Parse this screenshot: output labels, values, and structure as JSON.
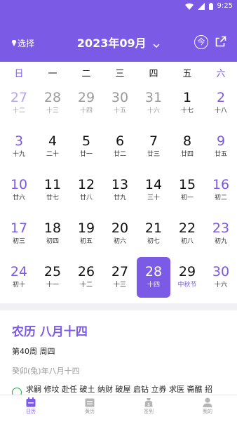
{
  "status": {
    "time": "9:25"
  },
  "header": {
    "location_label": "选择",
    "month_title": "2023年09月",
    "today_label": "今"
  },
  "weekdays": [
    {
      "label": "日",
      "weekend": true
    },
    {
      "label": "一",
      "weekend": false
    },
    {
      "label": "二",
      "weekend": false
    },
    {
      "label": "三",
      "weekend": false
    },
    {
      "label": "四",
      "weekend": false
    },
    {
      "label": "五",
      "weekend": false
    },
    {
      "label": "六",
      "weekend": true
    }
  ],
  "calendar_weeks": [
    [
      {
        "day": "27",
        "lunar": "十二",
        "other": true
      },
      {
        "day": "28",
        "lunar": "十三",
        "other": true
      },
      {
        "day": "29",
        "lunar": "十四",
        "other": true
      },
      {
        "day": "30",
        "lunar": "十五",
        "other": true
      },
      {
        "day": "31",
        "lunar": "十六",
        "other": true
      },
      {
        "day": "1",
        "lunar": "十七"
      },
      {
        "day": "2",
        "lunar": "十八"
      }
    ],
    [
      {
        "day": "3",
        "lunar": "十九"
      },
      {
        "day": "4",
        "lunar": "二十"
      },
      {
        "day": "5",
        "lunar": "廿一"
      },
      {
        "day": "6",
        "lunar": "廿二"
      },
      {
        "day": "7",
        "lunar": "廿三"
      },
      {
        "day": "8",
        "lunar": "廿四"
      },
      {
        "day": "9",
        "lunar": "廿五"
      }
    ],
    [
      {
        "day": "10",
        "lunar": "廿六"
      },
      {
        "day": "11",
        "lunar": "廿七"
      },
      {
        "day": "12",
        "lunar": "廿八"
      },
      {
        "day": "13",
        "lunar": "廿九"
      },
      {
        "day": "14",
        "lunar": "三十"
      },
      {
        "day": "15",
        "lunar": "初一"
      },
      {
        "day": "16",
        "lunar": "初二"
      }
    ],
    [
      {
        "day": "17",
        "lunar": "初三"
      },
      {
        "day": "18",
        "lunar": "初四"
      },
      {
        "day": "19",
        "lunar": "初五"
      },
      {
        "day": "20",
        "lunar": "初六"
      },
      {
        "day": "21",
        "lunar": "初七"
      },
      {
        "day": "22",
        "lunar": "初八"
      },
      {
        "day": "23",
        "lunar": "初九"
      }
    ],
    [
      {
        "day": "24",
        "lunar": "初十"
      },
      {
        "day": "25",
        "lunar": "十一"
      },
      {
        "day": "26",
        "lunar": "十二"
      },
      {
        "day": "27",
        "lunar": "十三"
      },
      {
        "day": "28",
        "lunar": "十四",
        "selected": true
      },
      {
        "day": "29",
        "lunar": "中秋节",
        "festival": true
      },
      {
        "day": "30",
        "lunar": "十六"
      }
    ]
  ],
  "detail": {
    "lunar_date": "农历 八月十四",
    "week_info": "第40周 周四",
    "ganzhi": "癸卯(兔)年八月十四",
    "yi": "求嗣 修坟 赴任 破土 纳财 破屋 启钻 立券 求医 斋醮 招"
  },
  "tabs": [
    {
      "label": "日历",
      "icon": "calendar-icon",
      "active": true
    },
    {
      "label": "黄历",
      "icon": "almanac-icon",
      "active": false
    },
    {
      "label": "签到",
      "icon": "checkin-icon",
      "active": false
    },
    {
      "label": "我的",
      "icon": "profile-icon",
      "active": false
    }
  ],
  "colors": {
    "accent": "#7b5ae6",
    "yi_icon": "#2aa74a"
  }
}
